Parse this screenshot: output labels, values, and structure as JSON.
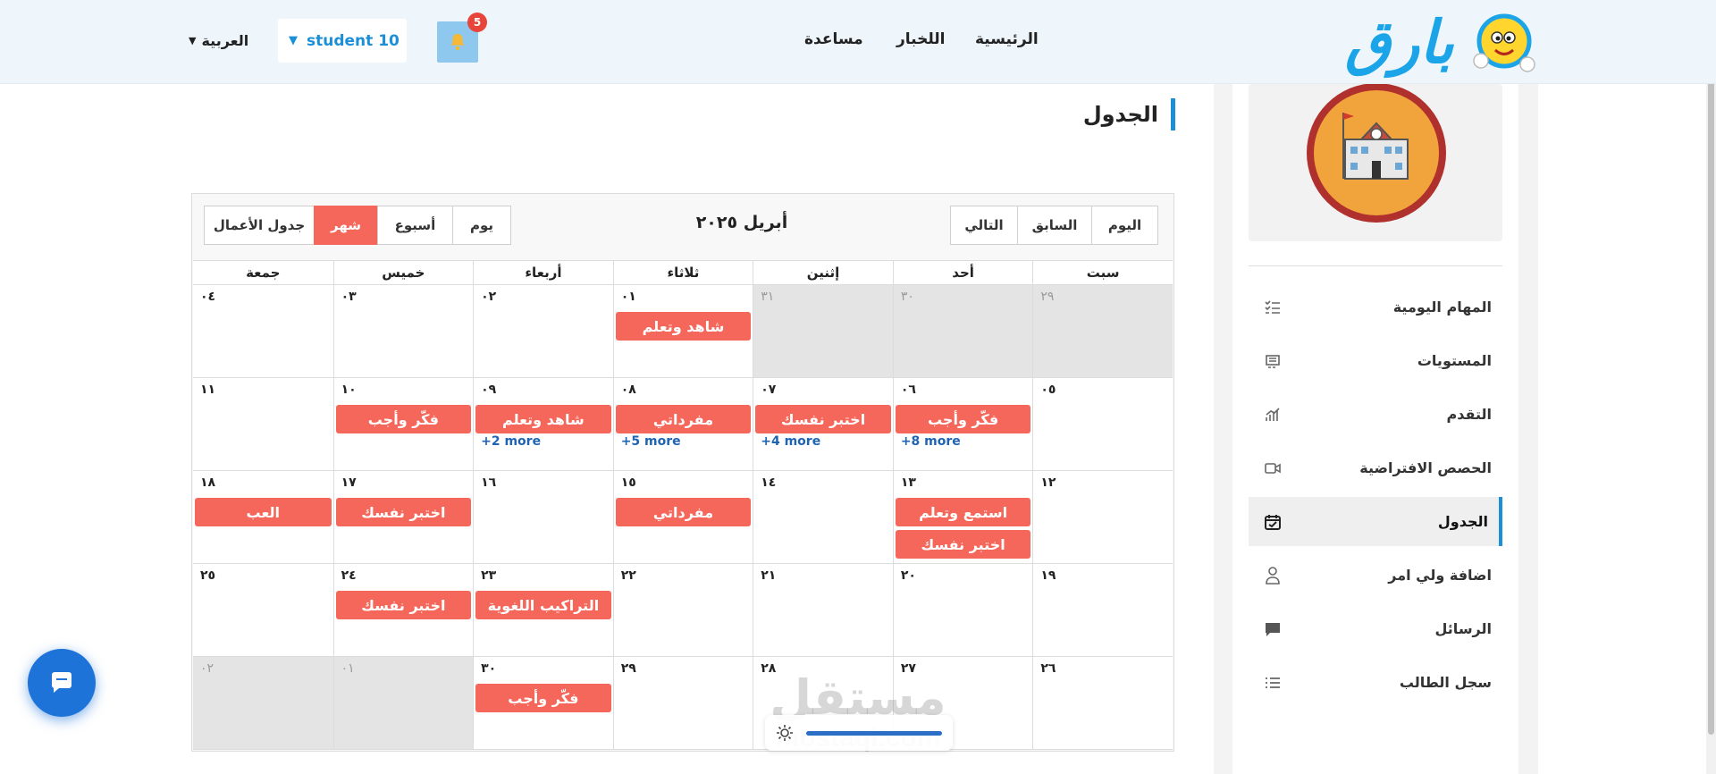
{
  "nav": {
    "logo_text": "بارق",
    "links": {
      "home": "الرئيسية",
      "news": "اللخبار",
      "help": "مساعدة"
    },
    "notifications_count": "5",
    "user": "student 10",
    "language": "العربية"
  },
  "sidebar": {
    "items": [
      {
        "label": "المهام اليومية",
        "icon": "checklist-icon"
      },
      {
        "label": "المستويات",
        "icon": "levels-icon"
      },
      {
        "label": "التقدم",
        "icon": "progress-chart-icon"
      },
      {
        "label": "الحصص الافتراضية",
        "icon": "video-camera-icon"
      },
      {
        "label": "الجدول",
        "icon": "calendar-check-icon",
        "active": true
      },
      {
        "label": "اضافة ولي امر",
        "icon": "parent-icon"
      },
      {
        "label": "الرسائل",
        "icon": "message-icon"
      },
      {
        "label": "سجل الطالب",
        "icon": "list-icon"
      }
    ]
  },
  "page": {
    "title": "الجدول"
  },
  "calendar": {
    "title": "أبريل ٢٠٢٥",
    "nav_buttons": {
      "today": "اليوم",
      "prev": "السابق",
      "next": "التالي"
    },
    "view_buttons": {
      "day": "يوم",
      "week": "أسبوع",
      "month": "شهر",
      "agenda": "جدول الأعمال"
    },
    "active_view": "month",
    "weekdays": [
      "سبت",
      "أحد",
      "إثنين",
      "ثلاثاء",
      "أربعاء",
      "خميس",
      "جمعة"
    ],
    "weeks": [
      [
        {
          "num": "٢٩",
          "other": true,
          "events": [],
          "more": ""
        },
        {
          "num": "٣٠",
          "other": true,
          "events": [],
          "more": ""
        },
        {
          "num": "٣١",
          "other": true,
          "events": [],
          "more": ""
        },
        {
          "num": "٠١",
          "other": false,
          "events": [
            "شاهد وتعلم"
          ],
          "more": ""
        },
        {
          "num": "٠٢",
          "other": false,
          "events": [],
          "more": ""
        },
        {
          "num": "٠٣",
          "other": false,
          "events": [],
          "more": ""
        },
        {
          "num": "٠٤",
          "other": false,
          "events": [],
          "more": ""
        }
      ],
      [
        {
          "num": "٠٥",
          "other": false,
          "events": [],
          "more": ""
        },
        {
          "num": "٠٦",
          "other": false,
          "events": [
            "فكّر وأجب"
          ],
          "more": "+8 more"
        },
        {
          "num": "٠٧",
          "other": false,
          "events": [
            "اختبر نفسك"
          ],
          "more": "+4 more"
        },
        {
          "num": "٠٨",
          "other": false,
          "events": [
            "مفرداتي"
          ],
          "more": "+5 more"
        },
        {
          "num": "٠٩",
          "other": false,
          "events": [
            "شاهد وتعلم"
          ],
          "more": "+2 more"
        },
        {
          "num": "١٠",
          "other": false,
          "events": [
            "فكّر وأجب"
          ],
          "more": ""
        },
        {
          "num": "١١",
          "other": false,
          "events": [],
          "more": ""
        }
      ],
      [
        {
          "num": "١٢",
          "other": false,
          "events": [],
          "more": ""
        },
        {
          "num": "١٣",
          "other": false,
          "events": [
            "استمع وتعلم",
            "اختبر نفسك"
          ],
          "more": ""
        },
        {
          "num": "١٤",
          "other": false,
          "events": [],
          "more": ""
        },
        {
          "num": "١٥",
          "other": false,
          "events": [
            "مفرداتي"
          ],
          "more": ""
        },
        {
          "num": "١٦",
          "other": false,
          "events": [],
          "more": ""
        },
        {
          "num": "١٧",
          "other": false,
          "events": [
            "اختبر نفسك"
          ],
          "more": ""
        },
        {
          "num": "١٨",
          "other": false,
          "events": [
            "العب"
          ],
          "more": ""
        }
      ],
      [
        {
          "num": "١٩",
          "other": false,
          "events": [],
          "more": ""
        },
        {
          "num": "٢٠",
          "other": false,
          "events": [],
          "more": ""
        },
        {
          "num": "٢١",
          "other": false,
          "events": [],
          "more": ""
        },
        {
          "num": "٢٢",
          "other": false,
          "events": [],
          "more": ""
        },
        {
          "num": "٢٣",
          "other": false,
          "events": [
            "التراكيب اللغوية"
          ],
          "more": ""
        },
        {
          "num": "٢٤",
          "other": false,
          "events": [
            "اختبر نفسك"
          ],
          "more": ""
        },
        {
          "num": "٢٥",
          "other": false,
          "events": [],
          "more": ""
        }
      ],
      [
        {
          "num": "٢٦",
          "other": false,
          "events": [],
          "more": ""
        },
        {
          "num": "٢٧",
          "other": false,
          "events": [],
          "more": ""
        },
        {
          "num": "٢٨",
          "other": false,
          "events": [],
          "more": ""
        },
        {
          "num": "٢٩",
          "other": false,
          "events": [],
          "more": ""
        },
        {
          "num": "٣٠",
          "other": false,
          "events": [
            "فكّر وأجب"
          ],
          "more": ""
        },
        {
          "num": "٠١",
          "other": true,
          "events": [],
          "more": ""
        },
        {
          "num": "٠٢",
          "other": true,
          "events": [],
          "more": ""
        }
      ]
    ]
  },
  "watermark": {
    "arabic": "مستقل",
    "latin": "mostaql.com"
  },
  "colors": {
    "accent": "#1c8fd7",
    "event": "#f4675a",
    "topbar": "#eef6fc"
  }
}
